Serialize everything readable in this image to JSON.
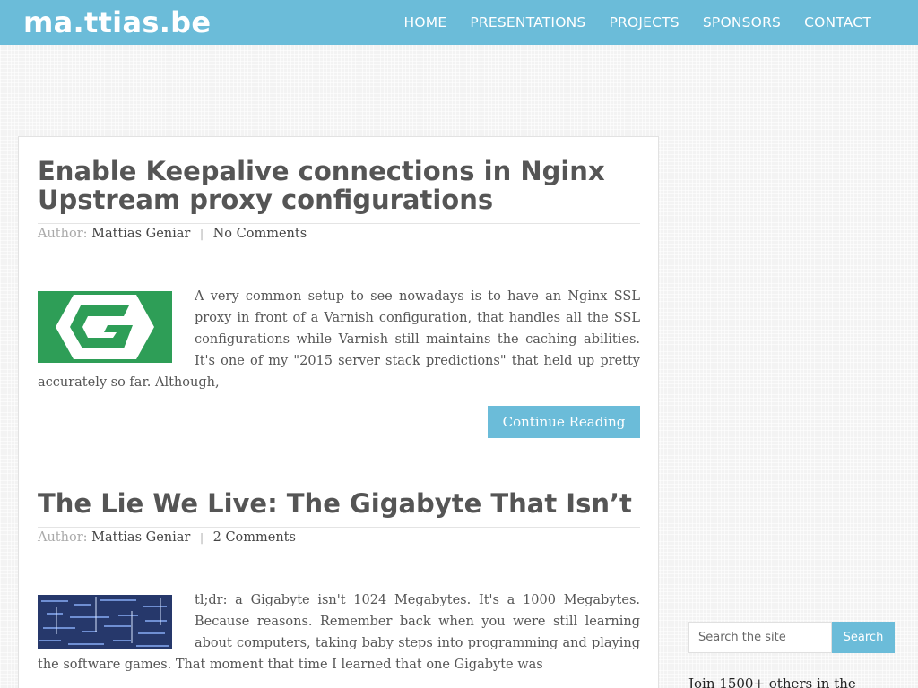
{
  "site": {
    "logo": "ma.ttias.be"
  },
  "nav": {
    "items": [
      {
        "label": "HOME"
      },
      {
        "label": "PRESENTATIONS"
      },
      {
        "label": "PROJECTS"
      },
      {
        "label": "SPONSORS"
      },
      {
        "label": "CONTACT"
      }
    ]
  },
  "posts": [
    {
      "title": "Enable Keepalive connections in Nginx Upstream proxy configurations",
      "author_label": "Author:",
      "author": "Mattias Geniar",
      "separator": "|",
      "comments": "No Comments",
      "excerpt": "A very common setup to see nowadays is to have an Nginx SSL proxy in front of a Varnish configuration, that handles all the SSL configurations while Varnish still maintains the caching abilities. It's one of my \"2015 server stack predictions\" that held up pretty accurately so far. Although,",
      "thumbnail_icon": "nginx-logo-icon",
      "thumbnail_color": "#2e9e57",
      "continue_label": "Continue Reading"
    },
    {
      "title": "The Lie We Live: The Gigabyte That Isn’t",
      "author_label": "Author:",
      "author": "Mattias Geniar",
      "separator": "|",
      "comments": "2 Comments",
      "excerpt": "tl;dr: a Gigabyte isn't 1024 Megabytes. It's a 1000 Megabytes. Because reasons. Remember back when you were still learning about computers, taking baby steps into programming and playing the software games. That moment that time I learned that one Gigabyte was",
      "thumbnail_icon": "binary-matrix-image",
      "thumbnail_color": "#2a3f78"
    }
  ],
  "sidebar": {
    "search_placeholder": "Search the site",
    "search_button": "Search",
    "join_text": "Join 1500+ others in the"
  },
  "colors": {
    "accent": "#6bbcd9",
    "title": "#555555",
    "meta_label": "#aaaaaa"
  }
}
